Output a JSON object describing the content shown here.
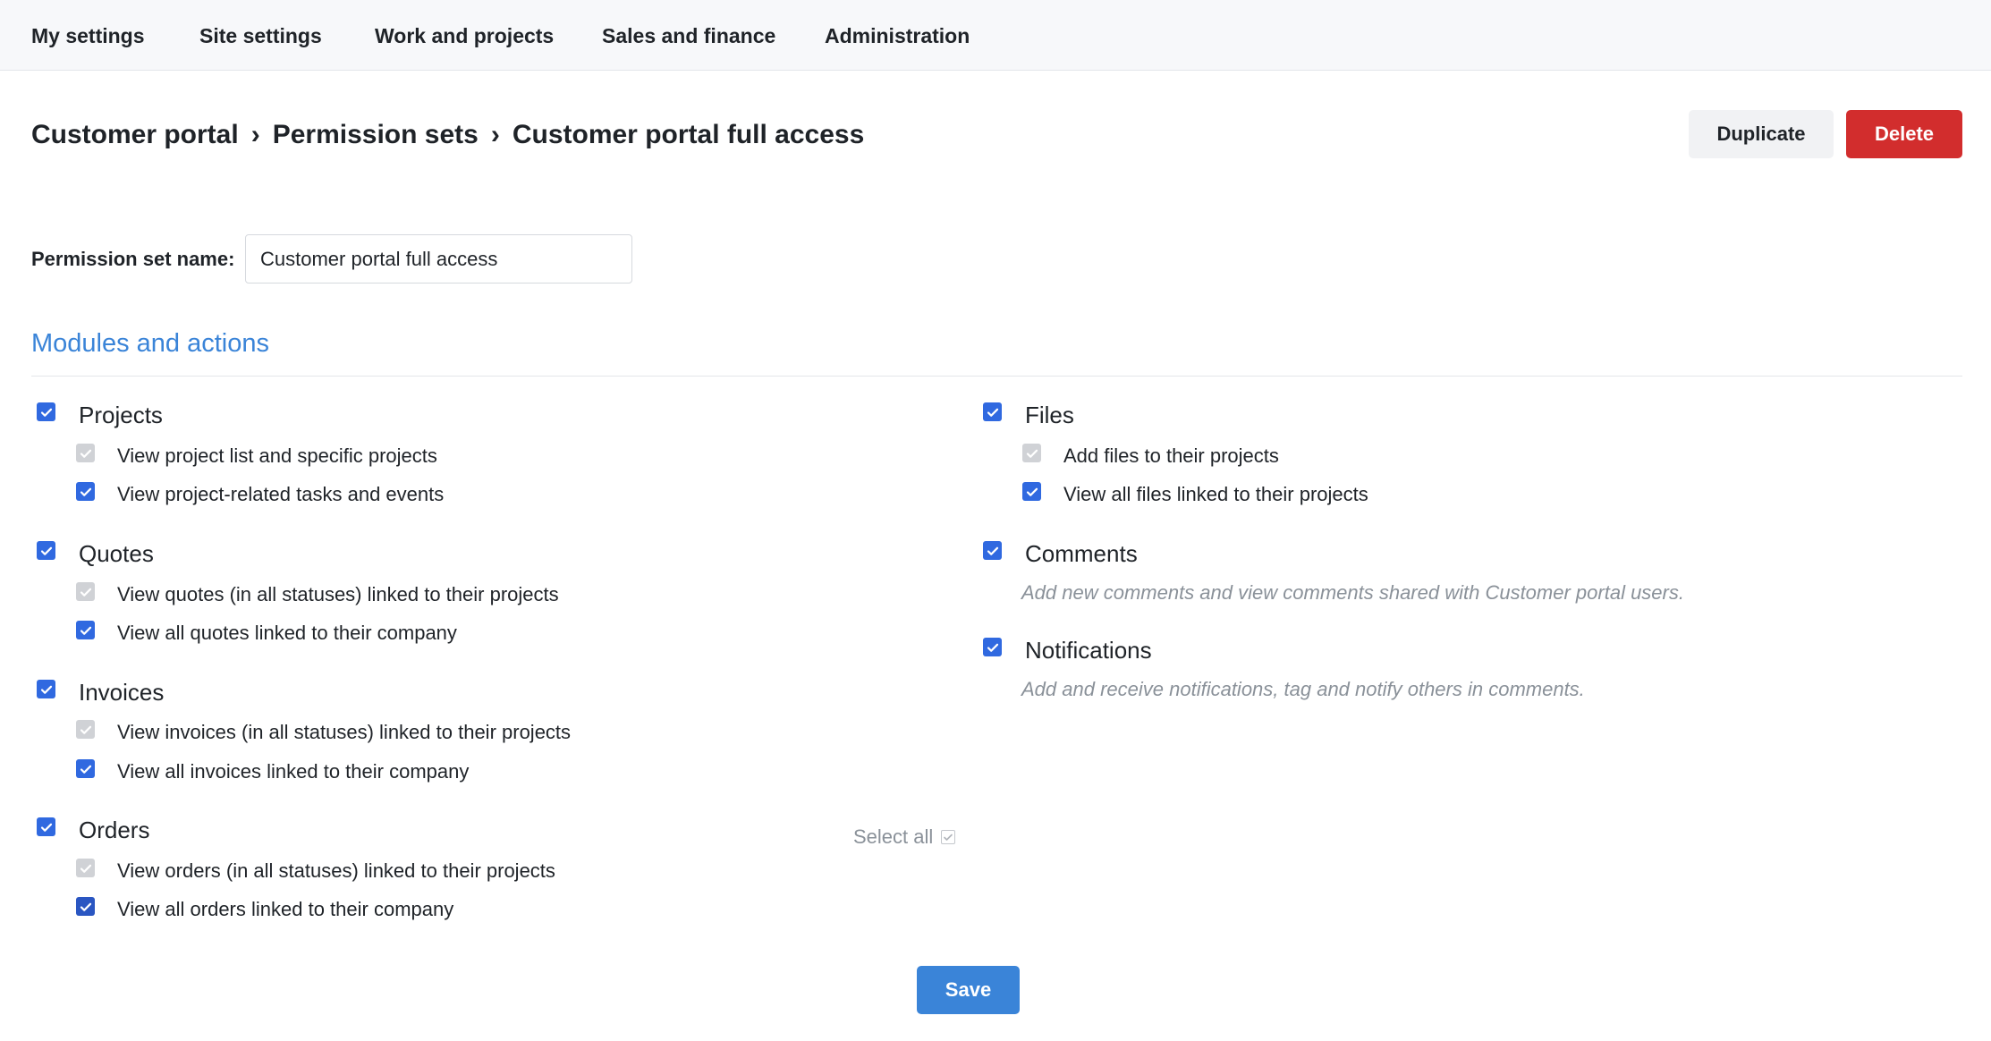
{
  "nav": {
    "items": [
      {
        "label": "My settings"
      },
      {
        "label": "Site settings"
      },
      {
        "label": "Work and projects"
      },
      {
        "label": "Sales and finance"
      },
      {
        "label": "Administration"
      }
    ]
  },
  "breadcrumb": {
    "items": [
      {
        "label": "Customer portal"
      },
      {
        "label": "Permission sets"
      },
      {
        "label": "Customer portal full access"
      }
    ],
    "separator": "›"
  },
  "actions": {
    "duplicate_label": "Duplicate",
    "delete_label": "Delete"
  },
  "form": {
    "name_label": "Permission set name:",
    "name_value": "Customer portal full access"
  },
  "section": {
    "title": "Modules and actions"
  },
  "modules_left": [
    {
      "label": "Projects",
      "checked": true,
      "actions": [
        {
          "label": "View project list and specific projects",
          "checked": true,
          "disabled": true
        },
        {
          "label": "View project-related tasks and events",
          "checked": true,
          "disabled": false
        }
      ]
    },
    {
      "label": "Quotes",
      "checked": true,
      "actions": [
        {
          "label": "View quotes (in all statuses) linked to their projects",
          "checked": true,
          "disabled": true
        },
        {
          "label": "View all quotes linked to their company",
          "checked": true,
          "disabled": false
        }
      ]
    },
    {
      "label": "Invoices",
      "checked": true,
      "actions": [
        {
          "label": "View invoices (in all statuses) linked to their projects",
          "checked": true,
          "disabled": true
        },
        {
          "label": "View all invoices linked to their company",
          "checked": true,
          "disabled": false
        }
      ]
    },
    {
      "label": "Orders",
      "checked": true,
      "actions": [
        {
          "label": "View orders (in all statuses) linked to their projects",
          "checked": true,
          "disabled": true
        },
        {
          "label": "View all orders linked to their company",
          "checked": true,
          "disabled": false
        }
      ]
    }
  ],
  "modules_right": [
    {
      "label": "Files",
      "checked": true,
      "actions": [
        {
          "label": "Add files to their projects",
          "checked": true,
          "disabled": true
        },
        {
          "label": "View all files linked to their projects",
          "checked": true,
          "disabled": false
        }
      ]
    },
    {
      "label": "Comments",
      "checked": true,
      "description": "Add new comments and view comments shared with Customer portal users."
    },
    {
      "label": "Notifications",
      "checked": true,
      "description": "Add and receive notifications, tag and notify others in comments."
    }
  ],
  "select_all": {
    "label": "Select all",
    "checked": true
  },
  "save": {
    "label": "Save"
  },
  "colors": {
    "accent": "#3a84d8",
    "checkbox": "#3069e0",
    "danger": "#d22d2d"
  }
}
